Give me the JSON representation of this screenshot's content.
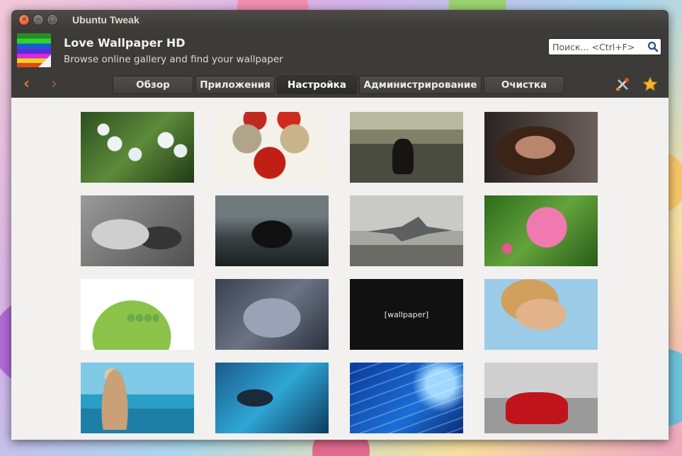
{
  "window": {
    "title": "Ubuntu Tweak",
    "buttons": {
      "close": "×",
      "minimize": "−",
      "maximize": "□"
    }
  },
  "header": {
    "title": "Love Wallpaper HD",
    "subtitle": "Browse online gallery and find your wallpaper",
    "search_placeholder": "Поиск... <Ctrl+F>"
  },
  "toolbar": {
    "back": "‹",
    "forward": "›",
    "tabs": [
      {
        "label": "Обзор",
        "active": false
      },
      {
        "label": "Приложения",
        "active": false
      },
      {
        "label": "Настройка",
        "active": true
      },
      {
        "label": "Администрирование",
        "active": false
      },
      {
        "label": "Очистка",
        "active": false
      }
    ]
  },
  "gallery": {
    "text_tile": "[wallpaper]"
  },
  "colors": {
    "dark_panel": "#3c3b37",
    "accent_orange": "#e8772e",
    "content_bg": "#f2f1f0"
  }
}
